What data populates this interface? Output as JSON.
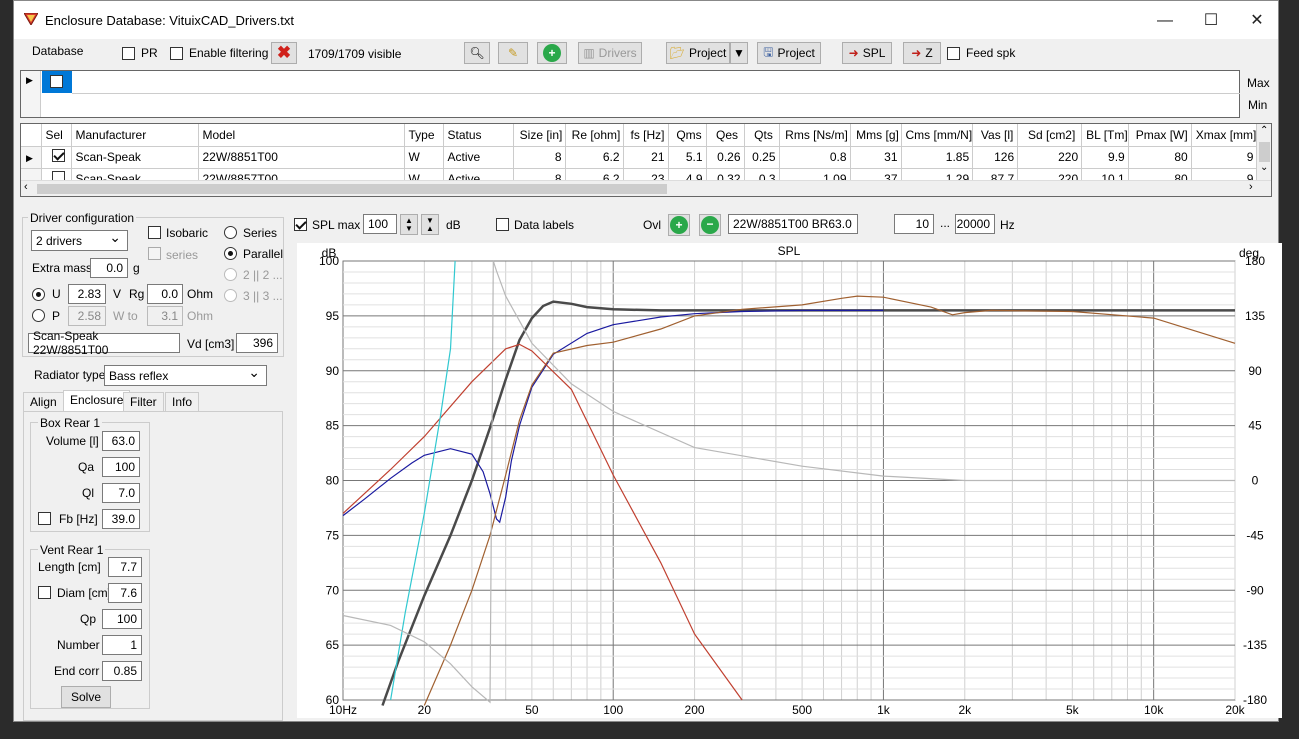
{
  "window": {
    "title": "Enclosure  Database: VituixCAD_Drivers.txt"
  },
  "toolbar": {
    "database_label": "Database",
    "pr_label": "PR",
    "enable_filtering_label": "Enable filtering",
    "visible_count": "1709/1709 visible",
    "drivers_label": "Drivers",
    "project_label_1": "Project",
    "project_label_2": "Project",
    "spl_label": "SPL",
    "z_label": "Z",
    "feed_spk_label": "Feed spk"
  },
  "filter_rows": {
    "max_label": "Max",
    "min_label": "Min"
  },
  "table": {
    "headers": [
      "Sel",
      "Manufacturer",
      "Model",
      "Type",
      "Status",
      "Size [in]",
      "Re [ohm]",
      "fs [Hz]",
      "Qms",
      "Qes",
      "Qts",
      "Rms [Ns/m]",
      "Mms [g]",
      "Cms [mm/N]",
      "Vas [l]",
      "Sd [cm2]",
      "BL [Tm]",
      "Pmax [W]",
      "Xmax [mm]"
    ],
    "rows": [
      [
        "",
        "Scan-Speak",
        "22W/8851T00",
        "W",
        "Active",
        "8",
        "6.2",
        "21",
        "5.1",
        "0.26",
        "0.25",
        "0.8",
        "31",
        "1.85",
        "126",
        "220",
        "9.9",
        "80",
        "9"
      ],
      [
        "",
        "Scan-Speak",
        "22W/8857T00",
        "W",
        "Active",
        "8",
        "6.2",
        "23",
        "4.9",
        "0.32",
        "0.3",
        "1.09",
        "37",
        "1.29",
        "87.7",
        "220",
        "10.1",
        "80",
        "9"
      ]
    ]
  },
  "driver_config": {
    "group_label": "Driver configuration",
    "drivers_select": "2 drivers",
    "isobaric_label": "Isobaric",
    "series_check_label": "series",
    "series_radio_label": "Series",
    "parallel_radio_label": "Parallel",
    "opt_2": "2 || 2 ...",
    "opt_3": "3 || 3 ...",
    "extra_mass_label": "Extra mass",
    "extra_mass_value": "0.0",
    "extra_mass_unit": "g",
    "u_label": "U",
    "u_value": "2.83",
    "u_unit": "V",
    "rg_label": "Rg",
    "rg_value": "0.0",
    "rg_unit": "Ohm",
    "p_label": "P",
    "p_value": "2.58",
    "w_to_label": "W to",
    "w_to_value": "3.1",
    "ohm2_label": "Ohm",
    "driver_name": "Scan-Speak 22W/8851T00",
    "vd_label": "Vd [cm3]",
    "vd_value": "396"
  },
  "radiator": {
    "label": "Radiator type",
    "value": "Bass reflex"
  },
  "tabs": [
    "Align",
    "Enclosure",
    "Filter",
    "Info"
  ],
  "box_rear": {
    "group_label": "Box Rear 1",
    "volume_label": "Volume [l]",
    "volume_value": "63.0",
    "qa_label": "Qa",
    "qa_value": "100",
    "ql_label": "Ql",
    "ql_value": "7.0",
    "fb_label": "Fb [Hz]",
    "fb_value": "39.0"
  },
  "vent_rear": {
    "group_label": "Vent Rear 1",
    "length_label": "Length [cm]",
    "length_value": "7.7",
    "diam_label": "Diam [cm]",
    "diam_value": "7.6",
    "qp_label": "Qp",
    "qp_value": "100",
    "number_label": "Number",
    "number_value": "1",
    "end_corr_label": "End corr",
    "end_corr_value": "0.85",
    "solve_label": "Solve"
  },
  "chart_toolbar": {
    "spl_max_label": "SPL max",
    "spl_max_value": "100",
    "db_unit": "dB",
    "data_labels_label": "Data labels",
    "ovl_label": "Ovl",
    "overlay_name": "22W/8851T00 BR63.0",
    "f_min": "10",
    "ellipsis": "...",
    "f_max": "20000",
    "hz_unit": "Hz"
  },
  "chart_data": {
    "type": "line",
    "title": "SPL",
    "ylabel_left": "dB",
    "ylabel_right": "deg",
    "x_scale": "log",
    "xlim": [
      10,
      20000
    ],
    "ylim": [
      60,
      100
    ],
    "ylim_right": [
      -180,
      180
    ],
    "x_ticks": [
      "10Hz",
      "20",
      "50",
      "100",
      "200",
      "500",
      "1k",
      "2k",
      "5k",
      "10k",
      "20k"
    ],
    "x_tick_values": [
      10,
      20,
      50,
      100,
      200,
      500,
      1000,
      2000,
      5000,
      10000,
      20000
    ],
    "y_ticks": [
      100,
      95,
      90,
      85,
      80,
      75,
      70,
      65,
      60
    ],
    "y_ticks_right": [
      180,
      135,
      90,
      45,
      0,
      -45,
      -90,
      -135,
      -180
    ],
    "grid": true,
    "series": [
      {
        "color": "#4a4a4a",
        "x": [
          14,
          16,
          20,
          25,
          30,
          35,
          40,
          45,
          50,
          55,
          60,
          70,
          80,
          100,
          150,
          200,
          500,
          1000,
          2000,
          5000,
          10000,
          20000
        ],
        "y": [
          59.5,
          63.5,
          69.5,
          75,
          80,
          84.8,
          89.2,
          92.8,
          94.8,
          95.9,
          96.3,
          96.1,
          95.8,
          95.6,
          95.5,
          95.5,
          95.5,
          95.5,
          95.5,
          95.5,
          95.5,
          95.5
        ]
      },
      {
        "color": "#1a1aa0",
        "x": [
          10,
          12,
          15,
          18,
          20,
          25,
          30,
          33,
          35,
          37,
          38,
          40,
          42,
          45,
          50,
          60,
          80,
          100,
          150,
          200,
          300,
          500,
          1000
        ],
        "y": [
          76.8,
          78.3,
          80.2,
          81.6,
          82.3,
          82.9,
          82.4,
          80.8,
          78.8,
          76.5,
          76.2,
          78.5,
          81.8,
          85,
          88.5,
          91.5,
          93.4,
          94.2,
          94.9,
          95.2,
          95.4,
          95.5,
          95.5
        ]
      },
      {
        "color": "#a06030",
        "x": [
          20,
          25,
          30,
          35,
          40,
          45,
          50,
          60,
          80,
          100,
          150,
          200,
          300,
          500,
          700,
          800,
          1000,
          1500,
          1800,
          2000,
          2500,
          5000,
          10000,
          20000
        ],
        "y": [
          59.5,
          65,
          70,
          75,
          80.5,
          85.5,
          88.7,
          91.6,
          92.3,
          92.6,
          93.8,
          95,
          95.6,
          96,
          96.6,
          96.8,
          96.7,
          95.8,
          95.1,
          95.3,
          95.5,
          95.4,
          94.8,
          92.5
        ]
      },
      {
        "color": "#c04030",
        "x": [
          10,
          15,
          20,
          30,
          40,
          45,
          50,
          70,
          100,
          150,
          200,
          300
        ],
        "y": [
          77,
          81,
          84,
          89,
          92,
          92.4,
          91.8,
          88.3,
          80.5,
          72.5,
          66,
          60
        ]
      },
      {
        "color": "#30c8d0",
        "x": [
          15,
          17,
          20,
          23,
          25,
          26
        ],
        "y": [
          60,
          68,
          77,
          86,
          92,
          100
        ]
      },
      {
        "color": "#b8b8b8",
        "x": [
          10,
          15,
          20,
          25,
          30,
          35,
          36,
          37,
          40,
          50,
          70,
          100,
          200,
          500,
          1000,
          2000,
          5000,
          10000,
          20000
        ],
        "y": [
          67.7,
          66.8,
          65.3,
          63.3,
          61.2,
          59.8,
          100,
          99.1,
          96.8,
          92.5,
          88.8,
          86.3,
          83,
          81.3,
          80.4,
          80,
          80,
          80,
          80
        ]
      }
    ]
  }
}
